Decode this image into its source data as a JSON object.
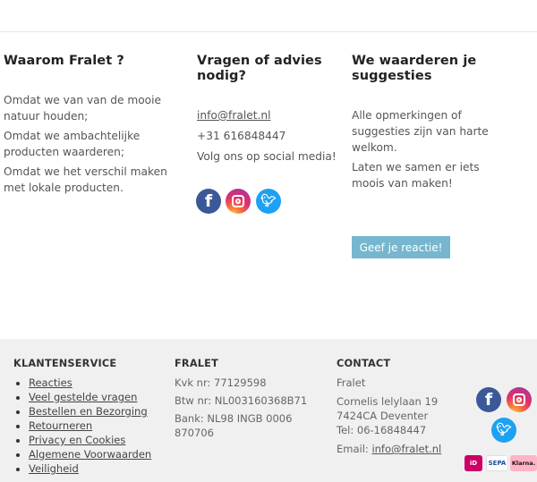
{
  "why": {
    "title": "Waarom Fralet ?",
    "paragraphs": [
      "Omdat we van van de mooie natuur houden;",
      "Omdat we ambachtelijke producten waarderen;",
      "Omdat we het verschil maken met lokale producten."
    ]
  },
  "questions": {
    "title": "Vragen of advies nodig?",
    "email": "info@fralet.nl",
    "phone": "+31 616848447",
    "social_text": "Volg ons op social media!",
    "social_icons": [
      "facebook-icon",
      "instagram-icon",
      "twitter-icon"
    ]
  },
  "suggestions": {
    "title": "We waarderen je suggesties",
    "paragraphs": [
      "Alle opmerkingen of suggesties zijn van harte welkom.",
      "Laten we samen er iets moois van maken!"
    ],
    "button_label": "Geef je reactie!"
  },
  "footer": {
    "service": {
      "title": "KLANTENSERVICE",
      "links": [
        "Reacties",
        "Veel gestelde vragen",
        "Bestellen en Bezorging",
        "Retourneren",
        "Privacy en Cookies",
        "Algemene Voorwaarden",
        "Veiligheid"
      ]
    },
    "company": {
      "title": "FRALET",
      "kvk": "Kvk nr: 77129598",
      "btw": "Btw nr: NL003160368B71",
      "bank": "Bank: NL98 INGB 0006 870706"
    },
    "contact": {
      "title": "CONTACT",
      "name": "Fralet",
      "address1": "Cornelis lelylaan 19",
      "address2": "7424CA  Deventer",
      "tel": "Tel: 06-16848447",
      "email_label": "Email: ",
      "email": "info@fralet.nl"
    },
    "payment": {
      "ideal": "iD",
      "sepa": "SEPA",
      "klarna": "Klarna."
    }
  },
  "colors": {
    "facebook": "#3b5998",
    "twitter": "#1da1f2",
    "button": "#76b6cf",
    "footer_bg": "#f0f0f0"
  }
}
